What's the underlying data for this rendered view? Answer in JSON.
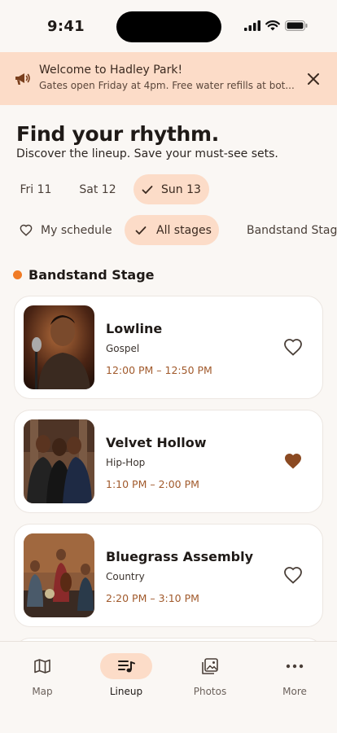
{
  "status": {
    "time": "9:41"
  },
  "banner": {
    "title": "Welcome to Hadley Park!",
    "message": "Gates open Friday at 4pm. Free water refills at bot..."
  },
  "hero": {
    "title": "Find your rhythm.",
    "subtitle": "Discover the lineup. Save your must-see sets."
  },
  "days": [
    {
      "label": "Fri 11",
      "selected": false
    },
    {
      "label": "Sat 12",
      "selected": false
    },
    {
      "label": "Sun 13",
      "selected": true
    }
  ],
  "filters": [
    {
      "label": "My schedule",
      "icon": "heart-outline-icon",
      "selected": false
    },
    {
      "label": "All stages",
      "icon": "check-icon",
      "selected": true
    },
    {
      "label": "Bandstand Stage",
      "icon": "orange-dot-icon",
      "selected": false
    }
  ],
  "section": {
    "title": "Bandstand Stage"
  },
  "acts": [
    {
      "name": "Lowline",
      "genre": "Gospel",
      "time": "12:00 PM – 12:50 PM",
      "favorited": false
    },
    {
      "name": "Velvet Hollow",
      "genre": "Hip-Hop",
      "time": "1:10 PM – 2:00 PM",
      "favorited": true
    },
    {
      "name": "Bluegrass Assembly",
      "genre": "Country",
      "time": "2:20 PM – 3:10 PM",
      "favorited": false
    }
  ],
  "tabs": [
    {
      "label": "Map",
      "icon": "map-icon",
      "active": false
    },
    {
      "label": "Lineup",
      "icon": "music-list-icon",
      "active": true
    },
    {
      "label": "Photos",
      "icon": "photos-icon",
      "active": false
    },
    {
      "label": "More",
      "icon": "more-dots-icon",
      "active": false
    }
  ],
  "colors": {
    "accent_bg": "#fcdcc8",
    "accent_text": "#a15a2c",
    "stage_dot": "#f07b25",
    "heart_filled": "#8b4a22"
  }
}
